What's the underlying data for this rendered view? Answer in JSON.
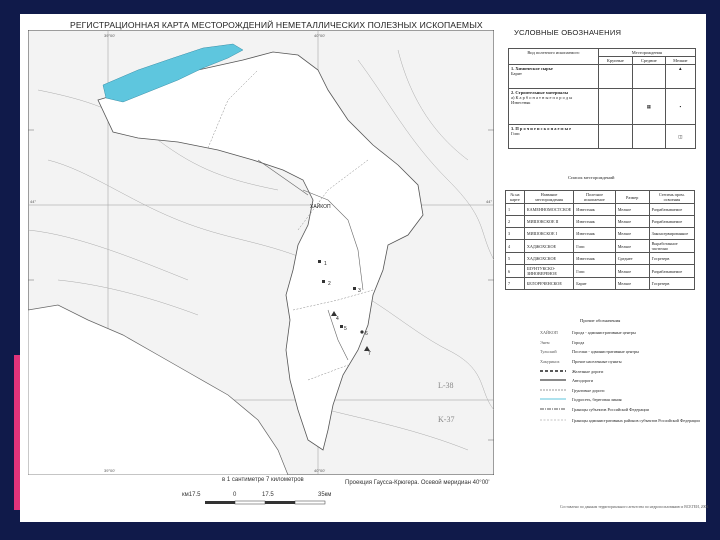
{
  "map": {
    "title": "РЕГИСТРАЦИОННАЯ КАРТА МЕСТОРОЖДЕНИЙ НЕМЕТАЛЛИЧЕСКИХ ПОЛЕЗНЫХ ИСКОПАЕМЫХ",
    "sheet_labels": [
      "L-38",
      "K-37"
    ],
    "city_label": "ХАЙКОП",
    "deposit_numbers": [
      "1",
      "2",
      "3",
      "4",
      "5",
      "6",
      "7"
    ],
    "meridian_labels": [
      "39°00'",
      "40°00'",
      "39°00'",
      "40°00'"
    ],
    "parallel_labels": [
      "45°",
      "44°",
      "44°",
      "43°"
    ]
  },
  "scale": {
    "text": "в 1 сантиметре 7 километров",
    "projection": "Проекция Гаусса-Крюгера. Осевой меридиан 40°00'",
    "ticks": [
      "км17.5",
      "0",
      "17.5",
      "35км"
    ]
  },
  "legend": {
    "title": "УСЛОВНЫЕ ОБОЗНАЧЕНИЯ",
    "header_type": "Вид полезного ископаемого",
    "header_deposits": "Месторождения",
    "sizes": [
      "Крупные",
      "Средние",
      "Мелкие"
    ],
    "rows": [
      {
        "label": "1. Химическое сырье",
        "sub": "Барит"
      },
      {
        "label": "2. Строительные материалы",
        "sub": "а) К а р б о н а т н ы е   п о р о д ы",
        "sub2": "Известняк"
      },
      {
        "label": "3. П р о ч и е   и с к о п а е м ы е",
        "sub": "Гипс"
      }
    ]
  },
  "deposits": {
    "title": "Список месторождений",
    "headers": [
      "№ на карте",
      "Название месторождения",
      "Полезное ископаемое",
      "Размер",
      "Степень пром. освоения"
    ],
    "rows": [
      [
        "1",
        "КАМЕННОМОСТСКОЕ",
        "Известняк",
        "Мелкое",
        "Разрабатываемое"
      ],
      [
        "2",
        "МИШОКСКОЕ II",
        "Известняк",
        "Мелкое",
        "Разрабатываемое"
      ],
      [
        "3",
        "МИШОКСКОЕ I",
        "Известняк",
        "Мелкое",
        "Законсервированное"
      ],
      [
        "4",
        "ХАДЖОХСКОЕ",
        "Гипс",
        "Мелкое",
        "Выработанное частично"
      ],
      [
        "5",
        "ХАДЖОХСКОЕ",
        "Известняк",
        "Среднее",
        "Госрезерв"
      ],
      [
        "6",
        "ШУНТУКСКО-ЗИНОВЕРЕНОЕ",
        "Гипс",
        "Мелкое",
        "Разрабатываемое"
      ],
      [
        "7",
        "БЕЛОРЕЧЕНСКОЕ",
        "Барит",
        "Мелкое",
        "Госрезерв"
      ]
    ]
  },
  "other": {
    "title": "Прочие обозначения",
    "rows": [
      {
        "sym": "ХАЙКОП",
        "label": "Города - административные центры"
      },
      {
        "sym": "Энем",
        "label": "Города"
      },
      {
        "sym": "Тульский",
        "label": "Поселки - административные центры"
      },
      {
        "sym": "Хакуринох",
        "label": "Прочие населенные пункты"
      },
      {
        "sym": "",
        "label": "Железные дороги"
      },
      {
        "sym": "",
        "label": "Автодороги"
      },
      {
        "sym": "",
        "label": "Грунтовые дороги"
      },
      {
        "sym": "",
        "label": "Гидросеть, береговая линия"
      },
      {
        "sym": "",
        "label": "Границы субъектов Российской Федерации"
      },
      {
        "sym": "",
        "label": "Границы административных районов субъектов Российской Федерации"
      }
    ]
  },
  "footnote": "Составлено по данным территориального агентства по недропользованию и ВСЕГЕИ, 2004",
  "colors": {
    "frame": "#101a4a",
    "accent": "#e1337a",
    "water": "#5ec6de",
    "region": "#ffffff",
    "outside": "#f3f3f3"
  }
}
